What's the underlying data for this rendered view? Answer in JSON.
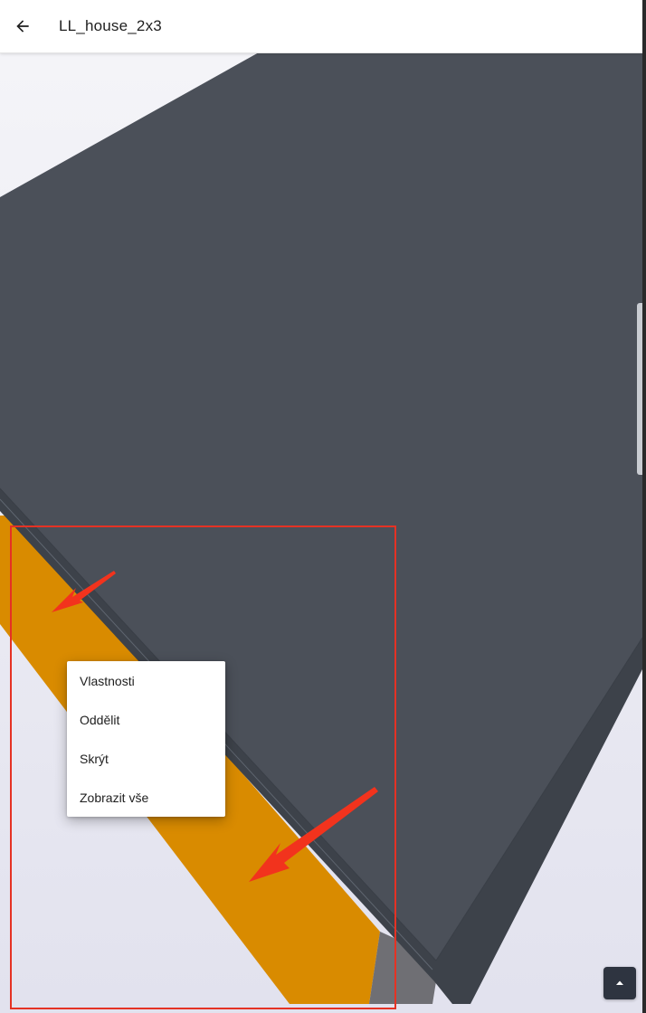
{
  "header": {
    "title": "LL_house_2x3",
    "back_icon": "arrow-left-icon"
  },
  "context_menu": {
    "items": [
      {
        "label": "Vlastnosti"
      },
      {
        "label": "Oddělit"
      },
      {
        "label": "Skrýt"
      },
      {
        "label": "Zobrazit vše"
      }
    ]
  },
  "colors": {
    "slab_top": "#4b5059",
    "slab_edge": "#3b4048",
    "beam": "#d98b00",
    "background": "#e6e6f0",
    "annotation": "#e53224"
  },
  "fab": {
    "icon": "caret-up-icon"
  }
}
